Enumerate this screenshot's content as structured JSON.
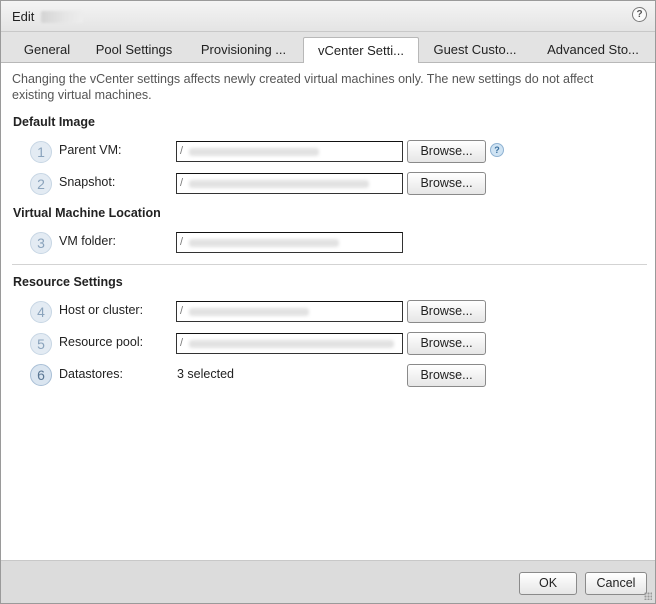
{
  "dialog": {
    "title": "Edit",
    "help_icon": "help-circle-icon"
  },
  "tabs": [
    {
      "label": "General"
    },
    {
      "label": "Pool Settings"
    },
    {
      "label": "Provisioning ..."
    },
    {
      "label": "vCenter Setti...",
      "active": true
    },
    {
      "label": "Guest Custo..."
    },
    {
      "label": "Advanced Sto..."
    }
  ],
  "notice": "Changing the vCenter settings affects newly created virtual machines only. The new settings do not affect existing virtual machines.",
  "sections": {
    "default_image": "Default Image",
    "vm_location": "Virtual Machine Location",
    "resource_settings": "Resource Settings"
  },
  "fields": {
    "parent_vm": {
      "step": "1",
      "label": "Parent VM:",
      "value": "/"
    },
    "snapshot": {
      "step": "2",
      "label": "Snapshot:",
      "value": "/"
    },
    "vm_folder": {
      "step": "3",
      "label": "VM folder:",
      "value": "/"
    },
    "host_cluster": {
      "step": "4",
      "label": "Host or cluster:",
      "value": "/"
    },
    "resource_pool": {
      "step": "5",
      "label": "Resource pool:",
      "value": "/"
    },
    "datastores": {
      "step": "6",
      "label": "Datastores:",
      "value": "3 selected"
    }
  },
  "buttons": {
    "browse": "Browse...",
    "ok": "OK",
    "cancel": "Cancel"
  },
  "colors": {
    "accent": "#5a7693",
    "step_bg": "#e3ebf3",
    "footer_bg": "#dcdcdc"
  }
}
